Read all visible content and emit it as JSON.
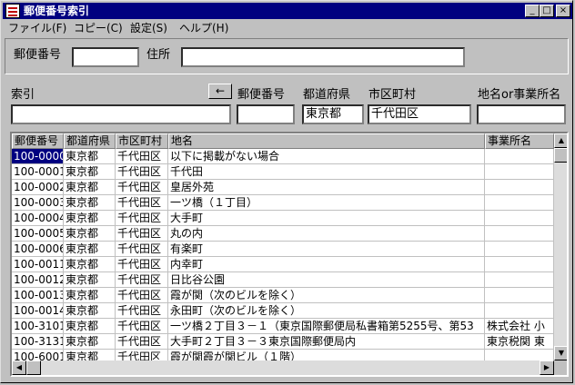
{
  "window": {
    "title": "郵便番号索引",
    "min": "_",
    "max": "□",
    "close": "×"
  },
  "menu": [
    "ファイル(F)",
    "コピー(C)",
    "設定(S)",
    "ヘルプ(H)"
  ],
  "top_panel": {
    "postal_label": "郵便番号",
    "postal_value": "",
    "address_label": "住所",
    "address_value": ""
  },
  "search": {
    "index_label": "索引",
    "index_value": "",
    "arrow": "←",
    "postal_label": "郵便番号",
    "postal_value": "",
    "prefecture_label": "都道府県",
    "prefecture_value": "東京都",
    "city_label": "市区町村",
    "city_value": "千代田区",
    "place_label": "地名or事業所名",
    "place_value": ""
  },
  "table": {
    "columns": [
      "郵便番号",
      "都道府県",
      "市区町村",
      "地名",
      "事業所名"
    ],
    "rows": [
      [
        "100-0000",
        "東京都",
        "千代田区",
        "以下に掲載がない場合",
        ""
      ],
      [
        "100-0001",
        "東京都",
        "千代田区",
        "千代田",
        ""
      ],
      [
        "100-0002",
        "東京都",
        "千代田区",
        "皇居外苑",
        ""
      ],
      [
        "100-0003",
        "東京都",
        "千代田区",
        "一ツ橋（１丁目）",
        ""
      ],
      [
        "100-0004",
        "東京都",
        "千代田区",
        "大手町",
        ""
      ],
      [
        "100-0005",
        "東京都",
        "千代田区",
        "丸の内",
        ""
      ],
      [
        "100-0006",
        "東京都",
        "千代田区",
        "有楽町",
        ""
      ],
      [
        "100-0011",
        "東京都",
        "千代田区",
        "内幸町",
        ""
      ],
      [
        "100-0012",
        "東京都",
        "千代田区",
        "日比谷公園",
        ""
      ],
      [
        "100-0013",
        "東京都",
        "千代田区",
        "霞が関（次のビルを除く）",
        ""
      ],
      [
        "100-0014",
        "東京都",
        "千代田区",
        "永田町（次のビルを除く）",
        ""
      ],
      [
        "100-3101",
        "東京都",
        "千代田区",
        "一ツ橋２丁目３－１（東京国際郵便局私書箱第5255号、第53",
        "株式会社 小"
      ],
      [
        "100-3131",
        "東京都",
        "千代田区",
        "大手町２丁目３－３東京国際郵便局内",
        "東京税関 東"
      ],
      [
        "100-6001",
        "東京都",
        "千代田区",
        "霞が関霞が関ビル（１階）",
        ""
      ]
    ]
  }
}
